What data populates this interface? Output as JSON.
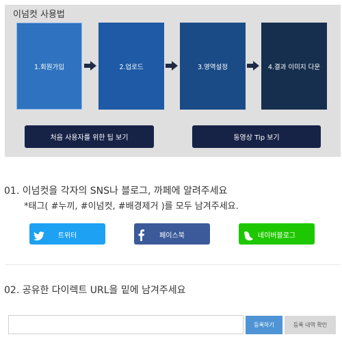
{
  "guide": {
    "title": "이넘컷 사용법",
    "steps": [
      {
        "label": "1.회원가입"
      },
      {
        "label": "2.업로드"
      },
      {
        "label": "3.영역설정"
      },
      {
        "label": "4.결과 이미지 다운"
      }
    ],
    "buttons": {
      "beginner_tips": "처음 사용자를 위한 팁 보기",
      "video_tips": "동영상 Tip 보기"
    }
  },
  "share_section": {
    "title": "01. 이넘컷을 각자의 SNS나 블로그, 까페에 알려주세요",
    "subtitle": "*태그( #누끼, #이넘컷, #배경제거 )를 모두 남겨주세요.",
    "buttons": [
      {
        "label": "트위터",
        "icon": "twitter-bird-icon",
        "color": "#1da1f2"
      },
      {
        "label": "페이스북",
        "icon": "facebook-f-icon",
        "color": "#3c5a99"
      },
      {
        "label": "네이버블로그",
        "icon": "naver-blog-icon",
        "color": "#1ec800"
      }
    ]
  },
  "url_section": {
    "title": "02. 공유한 다이렉트 URL을 밑에 남겨주세요",
    "input_value": "",
    "input_placeholder": "",
    "register_label": "등록하기",
    "history_label": "등록 내역 확인"
  }
}
